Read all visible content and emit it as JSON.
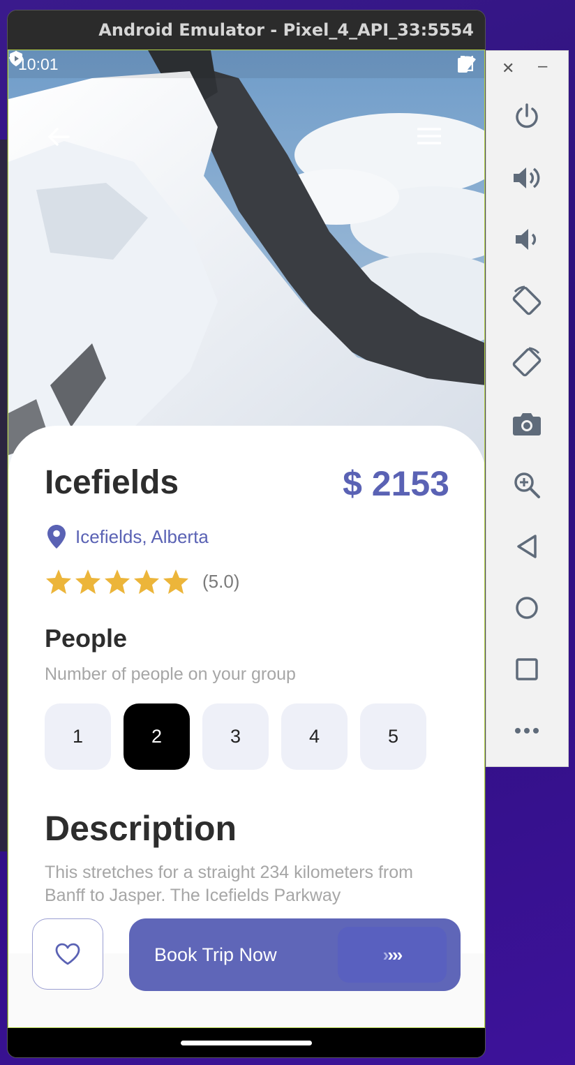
{
  "window": {
    "title": "Android Emulator - Pixel_4_API_33:5554"
  },
  "status_bar": {
    "time": "10:01"
  },
  "place": {
    "name": "Icefields",
    "price": "$ 2153",
    "location": "Icefields, Alberta",
    "stars": 5,
    "rating_text": "(5.0)"
  },
  "people": {
    "heading": "People",
    "subtitle": "Number of people on your group",
    "options": [
      "1",
      "2",
      "3",
      "4",
      "5"
    ],
    "selected": "2"
  },
  "description": {
    "heading": "Description",
    "text": "This stretches for a straight 234 kilometers from Banff to Jasper. The Icefields Parkway"
  },
  "actions": {
    "book_label": "Book Trip Now",
    "book_arrows_faint": "›",
    "book_arrows": "›››"
  },
  "colors": {
    "accent": "#5a62b4",
    "star": "#ecb53a",
    "selected_bg": "#000000",
    "chip_bg": "#eef0f8"
  },
  "toolbar_icons": [
    "close-icon",
    "minimize-icon",
    "power-icon",
    "volume-up-icon",
    "volume-down-icon",
    "rotate-left-icon",
    "rotate-right-icon",
    "camera-icon",
    "zoom-icon",
    "back-icon",
    "home-icon",
    "overview-icon",
    "more-icon"
  ]
}
